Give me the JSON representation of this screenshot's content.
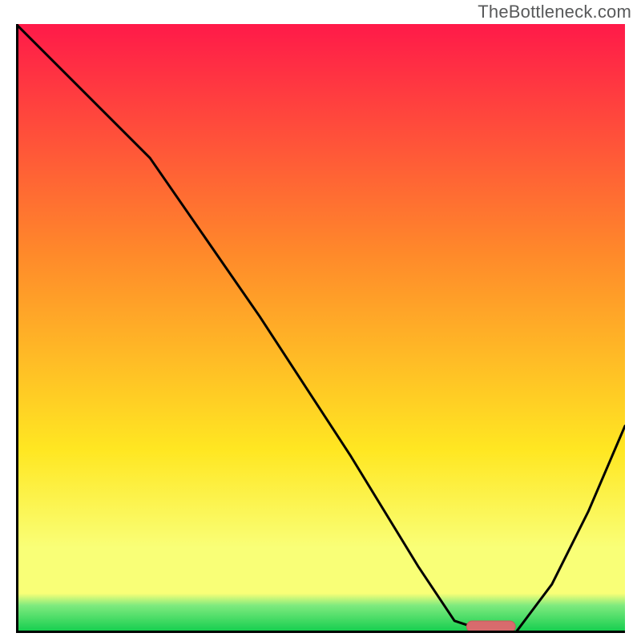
{
  "watermark": "TheBottleneck.com",
  "colors": {
    "axis": "#000000",
    "line": "#000000",
    "marker_fill": "#d86b6d",
    "marker_stroke": "#c95a5c",
    "grad_top": "#ff1a49",
    "grad_mid1": "#ff8a2a",
    "grad_mid2": "#ffe722",
    "grad_band": "#f9ff77",
    "grad_green_top": "#7eea7e",
    "grad_green_bot": "#0ecc4c"
  },
  "chart_data": {
    "type": "line",
    "title": "",
    "xlabel": "",
    "ylabel": "",
    "xlim": [
      0,
      100
    ],
    "ylim": [
      0,
      100
    ],
    "x": [
      0,
      12,
      22,
      40,
      55,
      66,
      72,
      78,
      82,
      88,
      94,
      100
    ],
    "values": [
      100,
      88,
      78,
      52,
      29,
      11,
      2,
      0,
      0,
      8,
      20,
      34
    ],
    "marker": {
      "x_start": 74,
      "x_end": 82,
      "y": 0
    },
    "grid": false,
    "legend": null
  }
}
